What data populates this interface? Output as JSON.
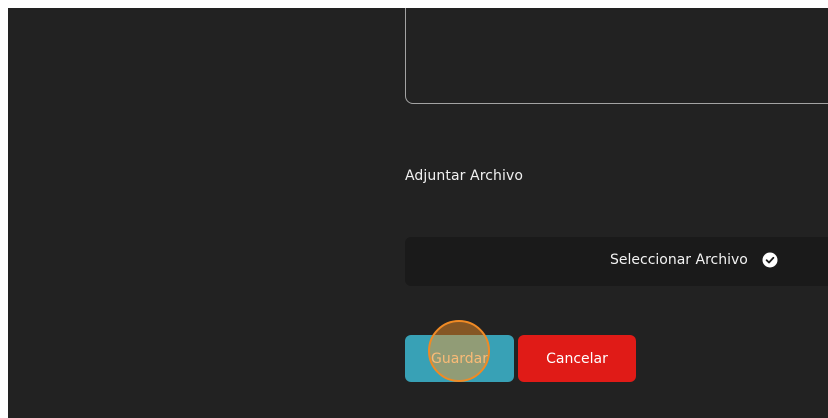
{
  "form": {
    "attachment_label": "Adjuntar Archivo",
    "file_select_label": "Seleccionar Archivo",
    "save_label": "Guardar",
    "cancel_label": "Cancelar"
  },
  "icons": {
    "file_select_icon": "check-circle-icon"
  },
  "colors": {
    "background": "#222222",
    "save_button": "#38a1b6",
    "cancel_button": "#e01b17",
    "click_marker": "#f08a24"
  }
}
